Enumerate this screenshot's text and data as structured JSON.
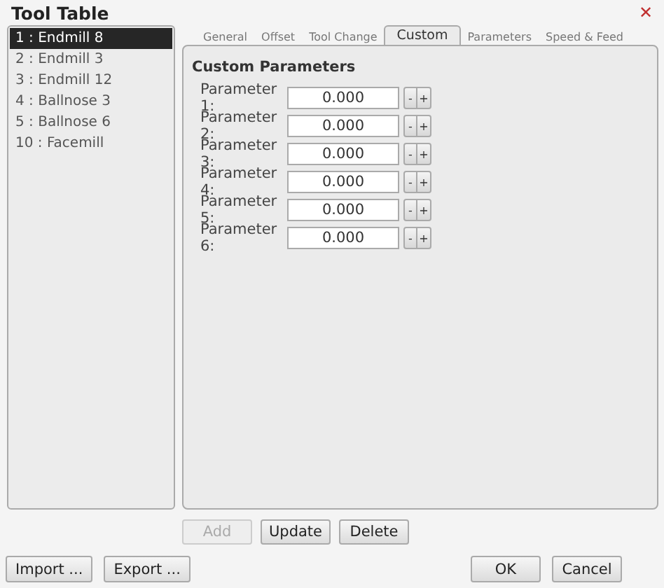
{
  "window": {
    "title": "Tool Table",
    "close": "✕"
  },
  "tools": [
    {
      "label": "1 : Endmill 8",
      "selected": true
    },
    {
      "label": "2 : Endmill 3",
      "selected": false
    },
    {
      "label": "3 : Endmill 12",
      "selected": false
    },
    {
      "label": "4 : Ballnose 3",
      "selected": false
    },
    {
      "label": "5 : Ballnose 6",
      "selected": false
    },
    {
      "label": "10 : Facemill",
      "selected": false
    }
  ],
  "tabs": [
    {
      "label": "General",
      "selected": false
    },
    {
      "label": "Offset",
      "selected": false
    },
    {
      "label": "Tool Change",
      "selected": false
    },
    {
      "label": "Custom",
      "selected": true
    },
    {
      "label": "Parameters",
      "selected": false
    },
    {
      "label": "Speed & Feed",
      "selected": false
    }
  ],
  "panel": {
    "heading": "Custom Parameters",
    "parameters": [
      {
        "label": "Parameter 1:",
        "value": "0.000",
        "minus": "-",
        "plus": "+"
      },
      {
        "label": "Parameter 2:",
        "value": "0.000",
        "minus": "-",
        "plus": "+"
      },
      {
        "label": "Parameter 3:",
        "value": "0.000",
        "minus": "-",
        "plus": "+"
      },
      {
        "label": "Parameter 4:",
        "value": "0.000",
        "minus": "-",
        "plus": "+"
      },
      {
        "label": "Parameter 5:",
        "value": "0.000",
        "minus": "-",
        "plus": "+"
      },
      {
        "label": "Parameter 6:",
        "value": "0.000",
        "minus": "-",
        "plus": "+"
      }
    ]
  },
  "actions": [
    {
      "label": "Add",
      "disabled": true
    },
    {
      "label": "Update",
      "disabled": false
    },
    {
      "label": "Delete",
      "disabled": false
    }
  ],
  "footer_left": [
    "Import ...",
    "Export ..."
  ],
  "footer_right": [
    "OK",
    "Cancel"
  ]
}
